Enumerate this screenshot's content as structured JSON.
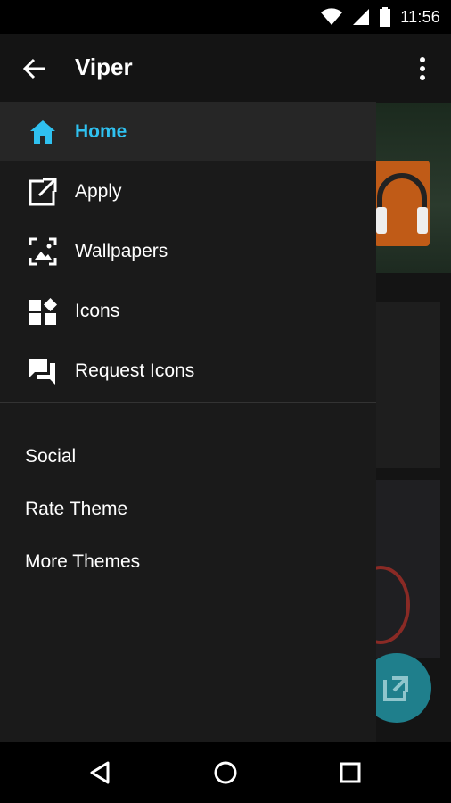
{
  "status_bar": {
    "time": "11:56",
    "icons": [
      "wifi-icon",
      "signal-icon",
      "battery-icon"
    ]
  },
  "toolbar": {
    "title": "Viper",
    "back_icon": "arrow-back-icon",
    "overflow_icon": "more-vert-icon"
  },
  "drawer": {
    "items": [
      {
        "label": "Home",
        "icon": "home-icon",
        "active": true
      },
      {
        "label": "Apply",
        "icon": "open-in-new-icon",
        "active": false
      },
      {
        "label": "Wallpapers",
        "icon": "wallpaper-icon",
        "active": false
      },
      {
        "label": "Icons",
        "icon": "widgets-icon",
        "active": false
      },
      {
        "label": "Request Icons",
        "icon": "forum-icon",
        "active": false
      }
    ],
    "links": [
      {
        "label": "Social"
      },
      {
        "label": "Rate Theme"
      },
      {
        "label": "More Themes"
      }
    ]
  },
  "colors": {
    "accent": "#2FC1F0",
    "drawer_bg": "#1A1A1A",
    "active_bg": "#262626",
    "text": "#FFFFFF"
  },
  "navigation_bar": {
    "buttons": [
      "back-nav-icon",
      "home-nav-icon",
      "recents-nav-icon"
    ]
  }
}
